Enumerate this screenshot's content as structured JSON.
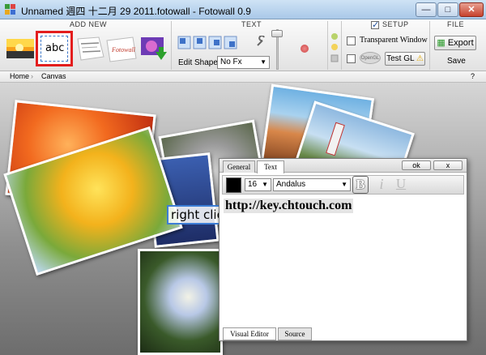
{
  "window": {
    "title": "Unnamed 週四 十二月 29 2011.fotowall - Fotowall 0.9",
    "minimize": "—",
    "maximize": "□",
    "close": "✕"
  },
  "ribbon": {
    "sections": {
      "add_new": "ADD NEW",
      "text": "TEXT",
      "setup": "SETUP",
      "file": "FILE"
    },
    "add_new": {
      "abc_label": "abc",
      "wordcloud_words": "ok fotowall",
      "fotowall_label": "Fotowall"
    },
    "text": {
      "edit_shape_label": "Edit Shape",
      "fx_select_value": "No Fx"
    },
    "setup": {
      "setup_checked": true,
      "transparent_window_label": "Transparent Window",
      "transparent_window_checked": false,
      "opengl_checked": false,
      "opengl_label": "OpenGL",
      "test_gl_button": "Test GL"
    },
    "file": {
      "export_button": "Export",
      "save_label": "Save"
    }
  },
  "breadcrumb": {
    "items": [
      "Home",
      "Canvas"
    ],
    "help": "?"
  },
  "canvas": {
    "text_item": "right clic"
  },
  "text_dialog": {
    "tabs": [
      "General",
      "Text"
    ],
    "active_tab": "Text",
    "ok_button": "ok",
    "close_button": "x",
    "font_size": "16",
    "font_name": "Andalus",
    "color": "#000000",
    "bold_label": "B",
    "italic_label": "i",
    "underline_label": "U",
    "content": "http://key.chtouch.com",
    "bottom_tabs": [
      "Visual Editor",
      "Source"
    ]
  },
  "colors": {
    "highlight_red": "#e31d1d",
    "titlebar": "#a9c8e8",
    "canvas_bg": "#8f8f8f"
  }
}
